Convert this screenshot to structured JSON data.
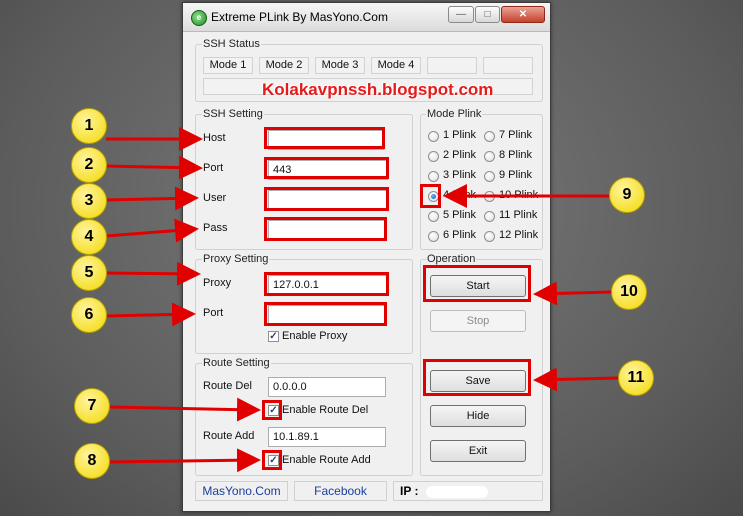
{
  "window": {
    "title": "Extreme PLink By MasYono.Com",
    "icon": "app-globe-icon"
  },
  "watermark": "Kolakavpnssh.blogspot.com",
  "ssh_status": {
    "label": "SSH Status",
    "modes": [
      "Mode 1",
      "Mode 2",
      "Mode 3",
      "Mode 4"
    ]
  },
  "ssh_setting": {
    "label": "SSH Setting",
    "host_label": "Host",
    "host_value": "",
    "port_label": "Port",
    "port_value": "443",
    "user_label": "User",
    "user_value": "",
    "pass_label": "Pass",
    "pass_value": ""
  },
  "proxy_setting": {
    "label": "Proxy Setting",
    "proxy_label": "Proxy",
    "proxy_value": "127.0.0.1",
    "port_label": "Port",
    "port_value": "",
    "enable_label": "Enable Proxy",
    "enable_checked": true
  },
  "route_setting": {
    "label": "Route Setting",
    "del_label": "Route Del",
    "del_value": "0.0.0.0",
    "enable_del_label": "Enable Route Del",
    "add_label": "Route Add",
    "add_value": "10.1.89.1",
    "enable_add_label": "Enable Route Add"
  },
  "mode_plink": {
    "label": "Mode Plink",
    "options": [
      "1 Plink",
      "2 Plink",
      "3 Plink",
      "4 Plink",
      "5 Plink",
      "6 Plink",
      "7 Plink",
      "8 Plink",
      "9 Plink",
      "10 Plink",
      "11 Plink",
      "12 Plink"
    ],
    "selected": "4 Plink"
  },
  "operation": {
    "label": "Operation",
    "start": "Start",
    "stop": "Stop",
    "save": "Save",
    "hide": "Hide",
    "exit": "Exit"
  },
  "status_bar": {
    "site": "MasYono.Com",
    "facebook": "Facebook",
    "ip_label": "IP :"
  },
  "callouts": [
    "1",
    "2",
    "3",
    "4",
    "5",
    "6",
    "7",
    "8",
    "9",
    "10",
    "11"
  ],
  "colors": {
    "highlight": "#e00000",
    "callout": "#f2d800",
    "link": "#1a3f9c"
  }
}
